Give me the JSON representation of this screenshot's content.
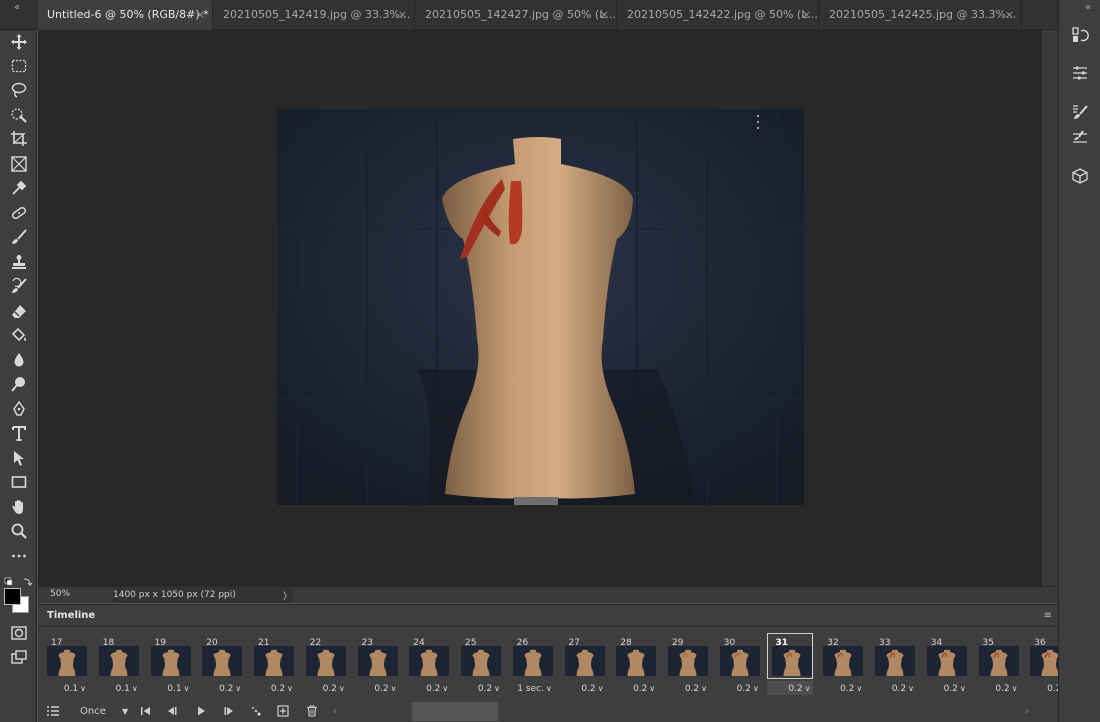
{
  "tabs": [
    {
      "label": "Untitled-6 @ 50% (RGB/8#) *",
      "active": true
    },
    {
      "label": "20210505_142419.jpg @ 33.3%...",
      "active": false
    },
    {
      "label": "20210505_142427.jpg @ 50% (L...",
      "active": false
    },
    {
      "label": "20210505_142422.jpg @ 50% (L...",
      "active": false
    },
    {
      "label": "20210505_142425.jpg @ 33.3%...",
      "active": false
    }
  ],
  "tab_close": "×",
  "collapse_icon": "«",
  "status": {
    "zoom": "50%",
    "dimensions": "1400 px x 1050 px (72 ppi)",
    "arrow": "〉"
  },
  "timeline": {
    "title": "Timeline",
    "menu": "≡",
    "loop": "Once",
    "frames": [
      {
        "num": "17",
        "delay": "0.1"
      },
      {
        "num": "18",
        "delay": "0.1"
      },
      {
        "num": "19",
        "delay": "0.1"
      },
      {
        "num": "20",
        "delay": "0.2"
      },
      {
        "num": "21",
        "delay": "0.2"
      },
      {
        "num": "22",
        "delay": "0.2"
      },
      {
        "num": "23",
        "delay": "0.2"
      },
      {
        "num": "24",
        "delay": "0.2"
      },
      {
        "num": "25",
        "delay": "0.2"
      },
      {
        "num": "26",
        "delay": "1 sec."
      },
      {
        "num": "27",
        "delay": "0.2"
      },
      {
        "num": "28",
        "delay": "0.2"
      },
      {
        "num": "29",
        "delay": "0.2"
      },
      {
        "num": "30",
        "delay": "0.2"
      },
      {
        "num": "31",
        "delay": "0.2",
        "selected": true
      },
      {
        "num": "32",
        "delay": "0.2"
      },
      {
        "num": "33",
        "delay": "0.2"
      },
      {
        "num": "34",
        "delay": "0.2"
      },
      {
        "num": "35",
        "delay": "0.2"
      },
      {
        "num": "36",
        "delay": "0.2"
      }
    ]
  },
  "tools": [
    "move-tool",
    "marquee-tool",
    "lasso-tool",
    "quick-selection-tool",
    "crop-tool",
    "frame-tool",
    "eyedropper-tool",
    "spot-healing-tool",
    "brush-tool",
    "clone-stamp-tool",
    "history-brush-tool",
    "eraser-tool",
    "paint-bucket-tool",
    "blur-tool",
    "dodge-tool",
    "pen-tool",
    "type-tool",
    "path-selection-tool",
    "rectangle-tool",
    "hand-tool",
    "zoom-tool",
    "more-tools"
  ],
  "colors": {
    "foreground": "#000000",
    "background": "#ffffff",
    "accent": "#cfcfcf"
  }
}
